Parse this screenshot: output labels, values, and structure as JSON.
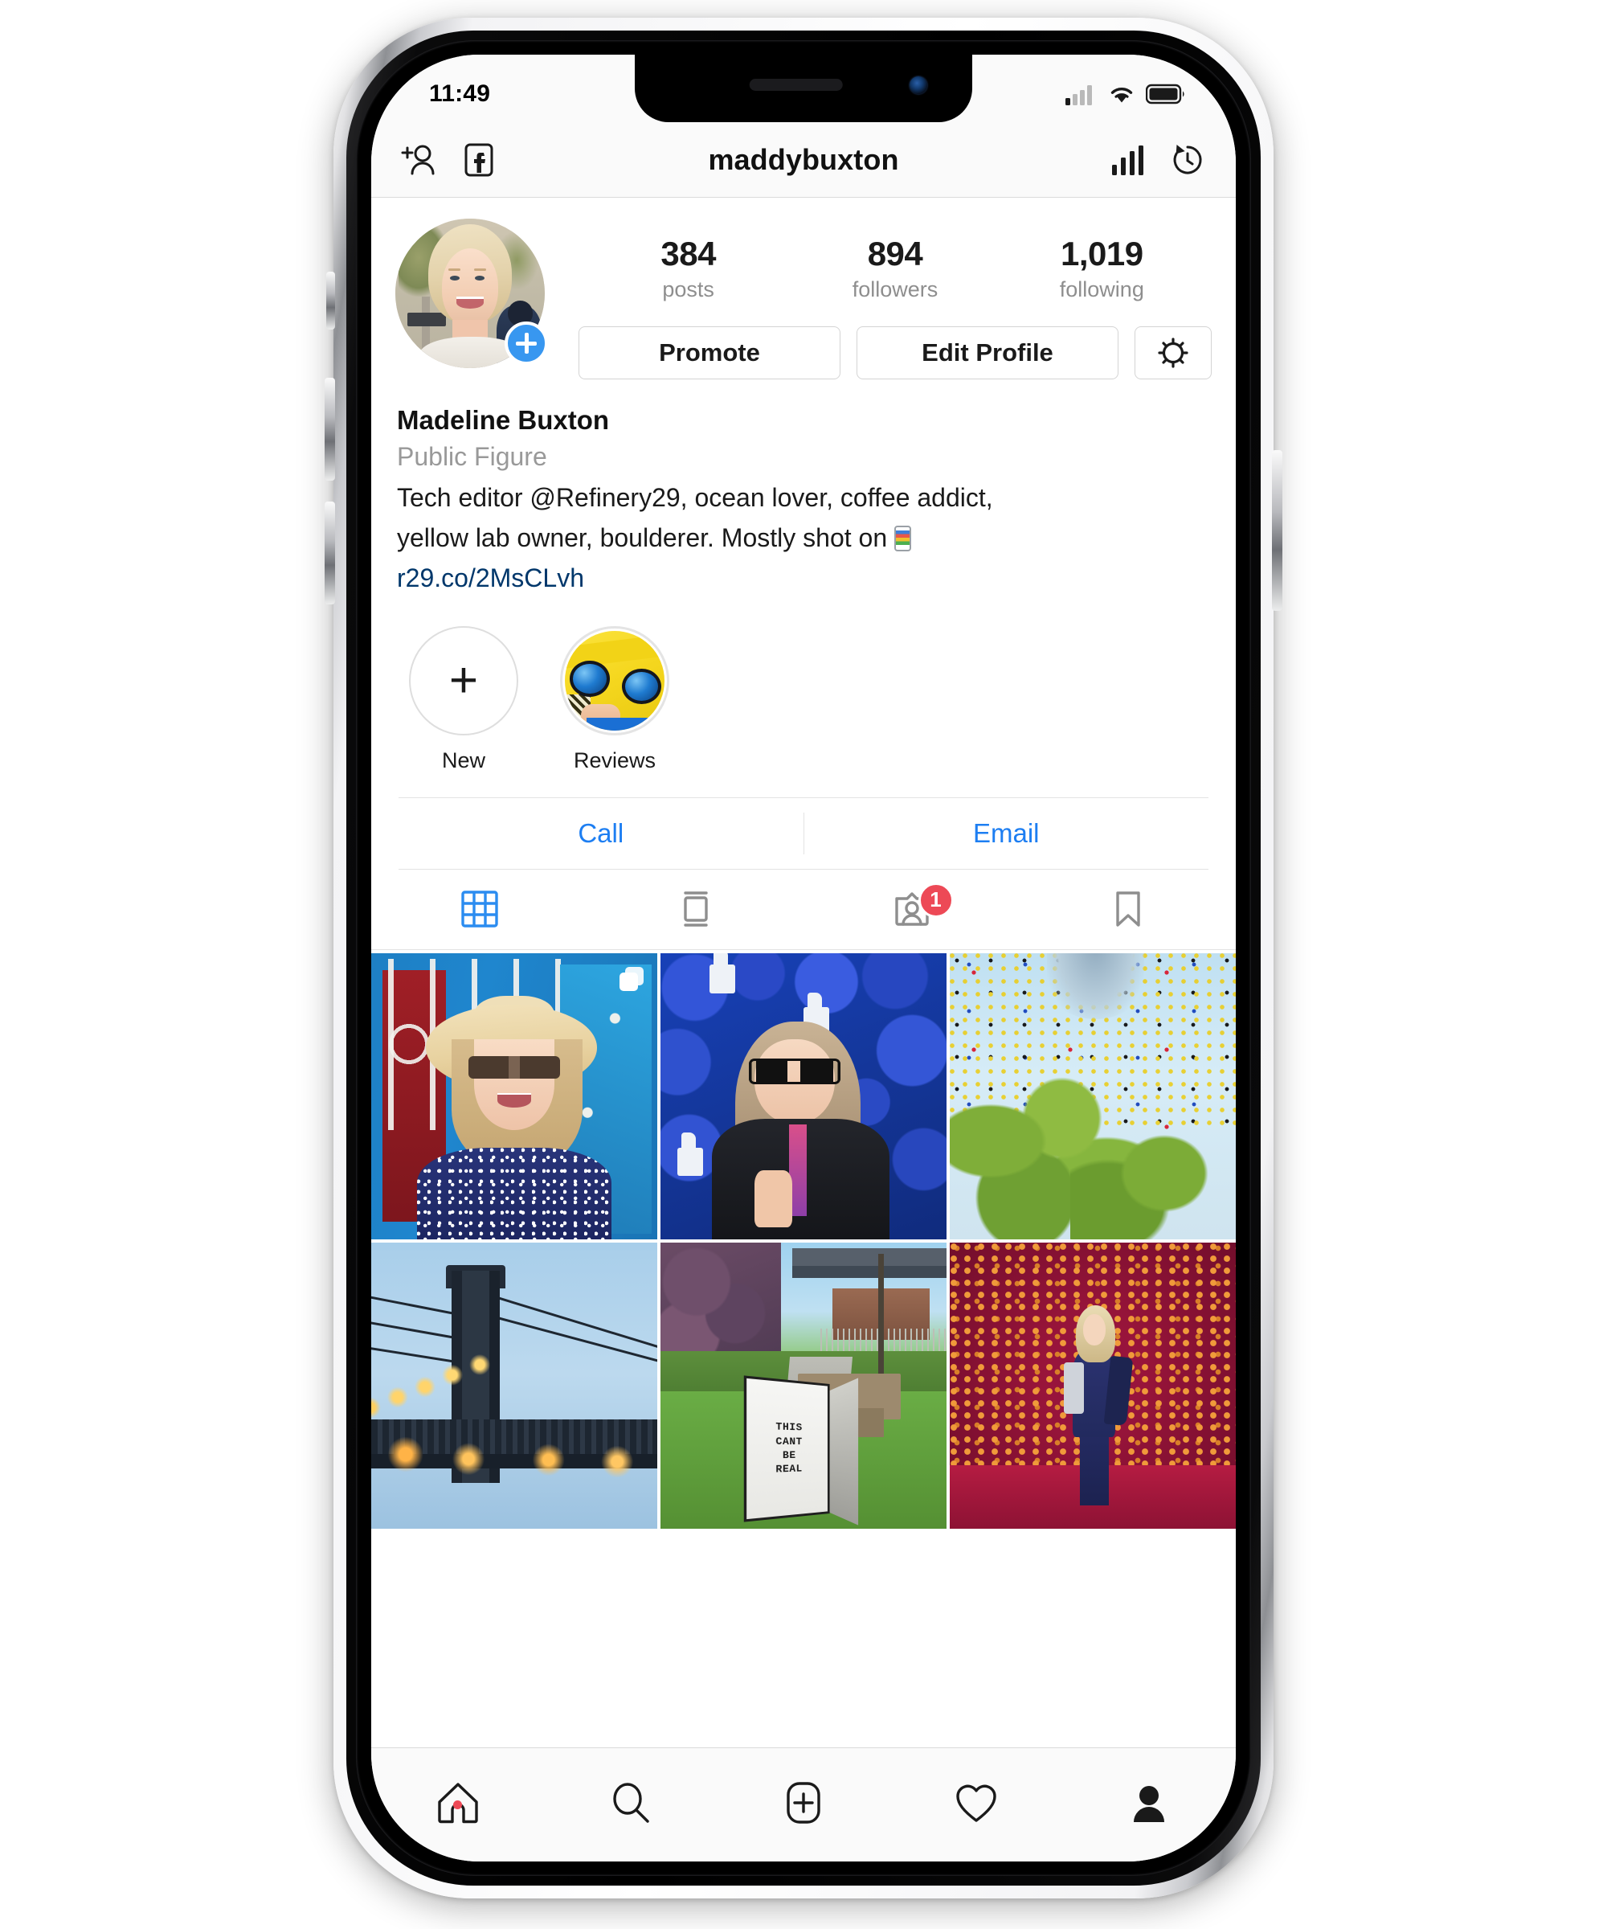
{
  "status_bar": {
    "time": "11:49",
    "cellular_icon": "cellular-signal-icon",
    "wifi_icon": "wifi-icon",
    "battery_icon": "battery-icon"
  },
  "header": {
    "add_person_icon": "add-person-icon",
    "facebook_icon": "facebook-icon",
    "username": "maddybuxton",
    "insights_icon": "insights-bar-chart-icon",
    "archive_icon": "archive-clock-icon"
  },
  "profile": {
    "avatar_name": "profile-avatar",
    "add_story_badge": "+",
    "stats": [
      {
        "value": "384",
        "label": "posts"
      },
      {
        "value": "894",
        "label": "followers"
      },
      {
        "value": "1,019",
        "label": "following"
      }
    ],
    "actions": {
      "promote": "Promote",
      "edit_profile": "Edit Profile",
      "settings_icon": "gear-icon"
    },
    "bio": {
      "name": "Madeline Buxton",
      "category": "Public Figure",
      "text_line1": "Tech editor @Refinery29, ocean lover, coffee addict,",
      "text_line2": "yellow lab owner, boulderer. Mostly shot on ",
      "emoji": "mobile-phone-emoji",
      "link": "r29.co/2MsCLvh"
    }
  },
  "highlights": [
    {
      "label": "New",
      "type": "new-highlight"
    },
    {
      "label": "Reviews",
      "type": "story-highlight"
    }
  ],
  "contact": {
    "call": "Call",
    "email": "Email"
  },
  "tabs": [
    {
      "name": "grid-tab",
      "icon": "grid-icon",
      "active": true,
      "badge": null
    },
    {
      "name": "list-tab",
      "icon": "list-feed-icon",
      "active": false,
      "badge": null
    },
    {
      "name": "tagged-tab",
      "icon": "tagged-person-icon",
      "active": false,
      "badge": "1"
    },
    {
      "name": "saved-tab",
      "icon": "bookmark-icon",
      "active": false,
      "badge": null
    }
  ],
  "grid_posts": [
    {
      "name": "post-hat-woman-blue-gate",
      "is_carousel": true,
      "alt": "Woman in straw hat and sunglasses in front of blue and red gate"
    },
    {
      "name": "post-blue-balloons-thumbsup",
      "is_carousel": false,
      "alt": "Woman with glasses giving thumbs up in front of blue balloon wall"
    },
    {
      "name": "post-circle-art-trees",
      "is_carousel": false,
      "alt": "Colorful circle net art installation above green trees"
    },
    {
      "name": "post-williamsburg-bridge",
      "is_carousel": false,
      "alt": "Bridge tower at dusk with string lights"
    },
    {
      "name": "post-this-cant-be-real-sign",
      "is_carousel": false,
      "alt": "Sandwich board sign reading THIS CANT BE REAL on lawn"
    },
    {
      "name": "post-orange-tube-room",
      "is_carousel": false,
      "alt": "Woman standing in room of orange tubes on pink floor"
    }
  ],
  "sign_text": [
    "THIS",
    "CANT",
    "BE",
    "REAL"
  ],
  "bottom_nav": [
    {
      "name": "home-tab",
      "icon": "home-icon",
      "active": false,
      "has_dot": true
    },
    {
      "name": "search-tab",
      "icon": "search-icon",
      "active": false,
      "has_dot": false
    },
    {
      "name": "add-post-tab",
      "icon": "add-square-icon",
      "active": false,
      "has_dot": false
    },
    {
      "name": "activity-tab",
      "icon": "heart-icon",
      "active": false,
      "has_dot": false
    },
    {
      "name": "profile-tab",
      "icon": "person-filled-icon",
      "active": true,
      "has_dot": false
    }
  ],
  "colors": {
    "instagram_blue": "#3897f0",
    "link_blue": "#1d7ef2",
    "bio_link_blue": "#00376b",
    "badge_red": "#ed4956",
    "secondary_text": "#8e8e8e"
  }
}
